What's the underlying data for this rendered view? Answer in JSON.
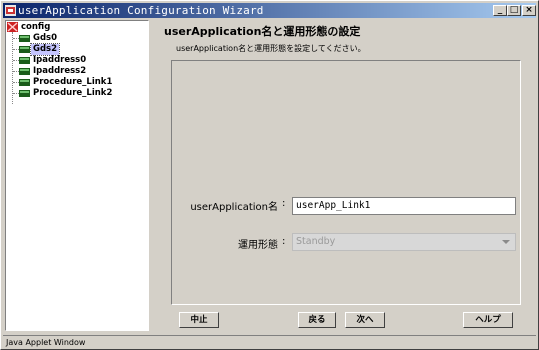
{
  "window": {
    "title": "userApplication Configuration Wizard",
    "buttons": {
      "minimize": "_",
      "maximize": "□",
      "close": "×"
    }
  },
  "tree": {
    "root": "config",
    "items": [
      {
        "label": "Gds0",
        "selected": false
      },
      {
        "label": "Gds2",
        "selected": true
      },
      {
        "label": "Ipaddress0",
        "selected": false
      },
      {
        "label": "Ipaddress2",
        "selected": false
      },
      {
        "label": "Procedure_Link1",
        "selected": false
      },
      {
        "label": "Procedure_Link2",
        "selected": false
      }
    ]
  },
  "main": {
    "title": "userApplication名と運用形態の設定",
    "description": "userApplication名と運用形態を設定してください。",
    "fields": {
      "name_label": "userApplication名",
      "name_colon": ":",
      "name_value": "userApp_Link1",
      "mode_label": "運用形態",
      "mode_colon": ":",
      "mode_value": "Standby"
    }
  },
  "footer": {
    "cancel": "中止",
    "back": "戻る",
    "next": "次へ",
    "help": "ヘルプ"
  },
  "status": "Java Applet Window"
}
